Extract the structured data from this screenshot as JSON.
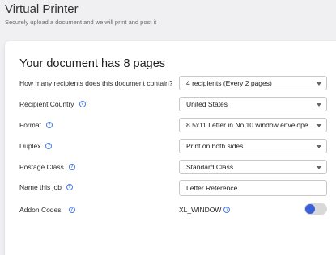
{
  "header": {
    "title": "Virtual Printer",
    "subtitle": "Securely upload a document and we will print and post it"
  },
  "form": {
    "heading": "Your document has 8 pages",
    "recipients": {
      "label": "How many recipients does this document contain?",
      "value": "4 recipients (Every 2 pages)"
    },
    "country": {
      "label": "Recipient Country",
      "value": "United States"
    },
    "format": {
      "label": "Format",
      "value": "8.5x11 Letter in No.10 window envelope"
    },
    "duplex": {
      "label": "Duplex",
      "value": "Print on both sides"
    },
    "postage": {
      "label": "Postage Class",
      "value": "Standard Class"
    },
    "job_name": {
      "label": "Name this job",
      "value": "Letter Reference"
    },
    "addon": {
      "label": "Addon Codes",
      "code": "XL_WINDOW",
      "enabled": false
    }
  },
  "colors": {
    "accent": "#3a5fd9",
    "help_icon": "#4a7be0"
  },
  "icons": {
    "help": "?"
  }
}
